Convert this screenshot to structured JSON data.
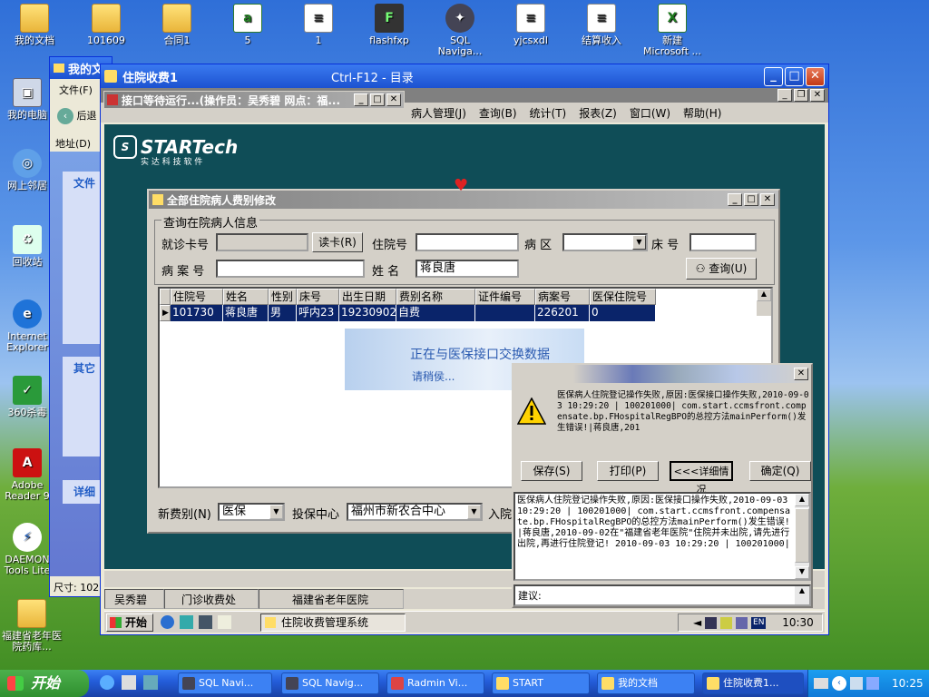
{
  "desktop": {
    "top_icons": [
      {
        "label": "我的文档",
        "type": "folder"
      },
      {
        "label": "101609",
        "type": "folder"
      },
      {
        "label": "合同1",
        "type": "folder"
      },
      {
        "label": "5",
        "type": "xls"
      },
      {
        "label": "1",
        "type": "doc"
      },
      {
        "label": "flashfxp",
        "type": "app"
      },
      {
        "label": "SQL Naviga...",
        "type": "app"
      },
      {
        "label": "yjcsxdl",
        "type": "doc"
      },
      {
        "label": "结算收入",
        "type": "doc"
      },
      {
        "label": "新建 Microsoft ...",
        "type": "xls"
      }
    ],
    "left_icons": [
      "我的电脑",
      "网上邻居",
      "回收站",
      "Internet Explorer",
      "360杀毒",
      "Adobe Reader 9",
      "DAEMON Tools Lite",
      "福建省老年医院药库..."
    ]
  },
  "explorer": {
    "title": "我的文",
    "menu_file": "文件(F)",
    "back": "后退",
    "address": "地址(D)",
    "task1": "文件",
    "task2": "其它",
    "task3": "详细",
    "status": "尺寸: 102"
  },
  "main": {
    "title": "住院收费1",
    "shortcut": "Ctrl-F12 - 目录",
    "menu": [
      "病人管理(J)",
      "查询(B)",
      "统计(T)",
      "报表(Z)",
      "窗口(W)",
      "帮助(H)"
    ],
    "logo": "STARTech",
    "logo_sub": "实 达 科 技 软 件",
    "status": [
      "吴秀碧",
      "门诊收费处",
      "福建省老年医院"
    ]
  },
  "wait_win": {
    "title": "接口等待运行...(操作员：吴秀碧 网点：福..."
  },
  "fee_win": {
    "title": "全部住院病人费别修改",
    "group": "查询在院病人信息",
    "card_label": "就诊卡号",
    "read_card": "读卡(R)",
    "inpatient_label": "住院号",
    "ward_label": "病 区",
    "bed_label": "床 号",
    "case_label": "病 案 号",
    "name_label": "姓 名",
    "name_value": "蒋良唐",
    "query_btn": "查询(U)",
    "columns": [
      "住院号",
      "姓名",
      "性别",
      "床号",
      "出生日期",
      "费别名称",
      "证件编号",
      "病案号",
      "医保住院号"
    ],
    "row": [
      "101730",
      "蒋良唐",
      "男",
      "呼内23",
      "19230902",
      "自费",
      "",
      "226201",
      "0"
    ],
    "new_fee_label": "新费别(N)",
    "new_fee_value": "医保",
    "insure_label": "投保中心",
    "insure_value": "福州市新农合中心",
    "in_label": "入院"
  },
  "exchange": {
    "text": "正在与医保接口交换数据",
    "wait": "请稍侯..."
  },
  "error_dialog": {
    "message": "医保病人住院登记操作失败,原因:医保接口操作失败,2010-09-03 10:29:20 | 100201000| com.start.ccmsfront.compensate.bp.FHospitalRegBPO的总控方法mainPerform()发生错误!|蒋良唐,201",
    "buttons": [
      "保存(S)",
      "打印(P)",
      "<<<详细情况",
      "确定(Q)"
    ],
    "detail": "医保病人住院登记操作失败,原因:医保接口操作失败,2010-09-03 10:29:20 | 100201000| com.start.ccmsfront.compensate.bp.FHospitalRegBPO的总控方法mainPerform()发生错误!|蒋良唐,2010-09-02在\"福建省老年医院\"住院并未出院,请先进行出院,再进行住院登记! 2010-09-03 10:29:20 | 100201000|",
    "suggest": "建议:"
  },
  "inner_taskbar": {
    "start": "开始",
    "app": "住院收费管理系统",
    "time": "10:30"
  },
  "taskbar": {
    "start": "开始",
    "items": [
      "SQL Navi...",
      "SQL Navig...",
      "Radmin Vi...",
      "START",
      "我的文档",
      "住院收费1..."
    ],
    "time": "10:25"
  },
  "colors": {
    "xp_blue": "#245edb",
    "classic_title": "#0a246a",
    "app_bg": "#0f4d57",
    "select": "#0a246a"
  }
}
